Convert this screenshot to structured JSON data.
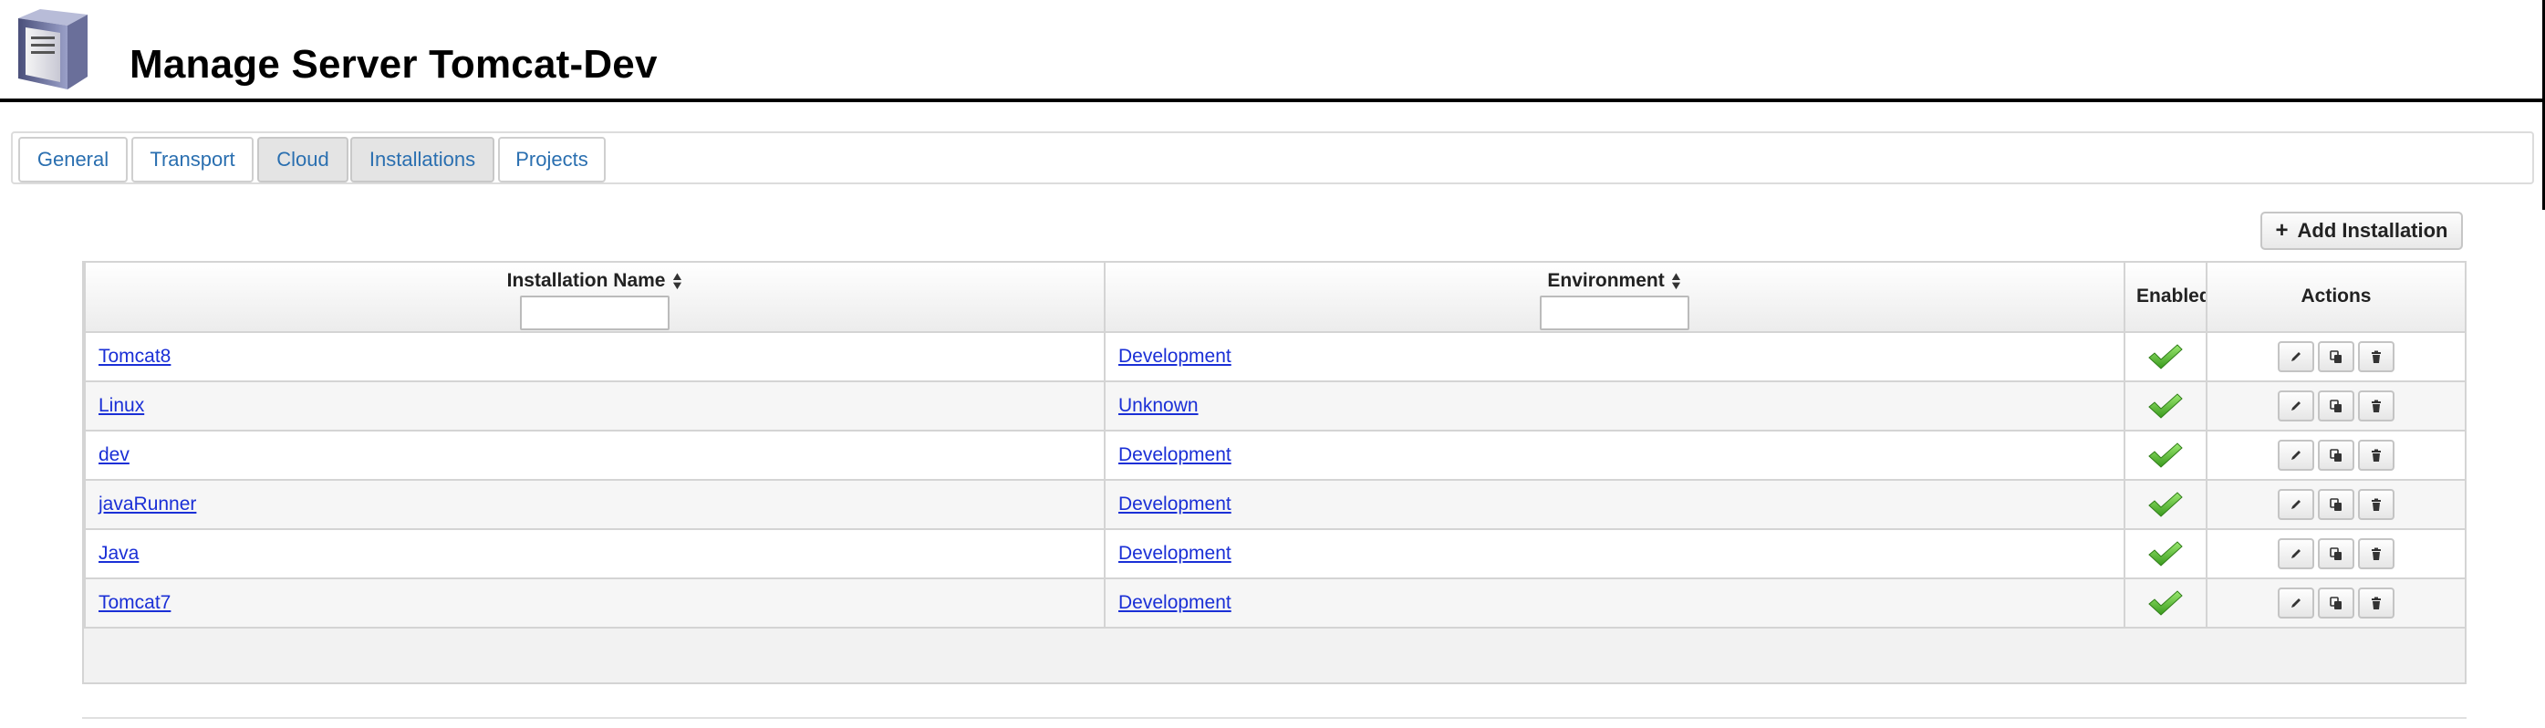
{
  "header": {
    "title": "Manage Server Tomcat-Dev",
    "icon": "server-icon"
  },
  "tabs": [
    {
      "label": "General",
      "active": false
    },
    {
      "label": "Transport",
      "active": false
    },
    {
      "label": "Cloud",
      "active": false
    },
    {
      "label": "Installations",
      "active": true
    },
    {
      "label": "Projects",
      "active": false
    }
  ],
  "toolbar": {
    "add_label": "Add Installation",
    "add_icon": "plus-icon"
  },
  "table": {
    "columns": {
      "name": "Installation Name",
      "environment": "Environment",
      "enabled": "Enabled",
      "actions": "Actions"
    },
    "filters": {
      "name_value": "",
      "environment_value": ""
    },
    "rows": [
      {
        "name": "Tomcat8",
        "environment": "Development",
        "enabled": true
      },
      {
        "name": "Linux",
        "environment": "Unknown",
        "enabled": true
      },
      {
        "name": "dev",
        "environment": "Development",
        "enabled": true
      },
      {
        "name": "javaRunner",
        "environment": "Development",
        "enabled": true
      },
      {
        "name": "Java",
        "environment": "Development",
        "enabled": true
      },
      {
        "name": "Tomcat7",
        "environment": "Development",
        "enabled": true
      }
    ],
    "action_icons": [
      "edit-icon",
      "copy-icon",
      "delete-icon"
    ]
  },
  "colors": {
    "link": "#1a2fd6",
    "tab_text": "#2a6fb0",
    "check": "#5cc030"
  }
}
